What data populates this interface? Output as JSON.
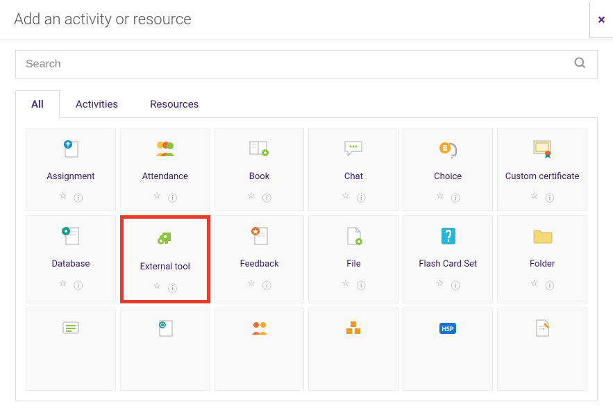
{
  "dialog": {
    "title": "Add an activity or resource",
    "close": "×"
  },
  "search": {
    "placeholder": "Search"
  },
  "tabs": {
    "all": "All",
    "activities": "Activities",
    "resources": "Resources"
  },
  "grid": {
    "items": [
      {
        "label": "Assignment",
        "icon": "assignment"
      },
      {
        "label": "Attendance",
        "icon": "attendance"
      },
      {
        "label": "Book",
        "icon": "book"
      },
      {
        "label": "Chat",
        "icon": "chat"
      },
      {
        "label": "Choice",
        "icon": "choice"
      },
      {
        "label": "Custom certificate",
        "icon": "certificate"
      },
      {
        "label": "Database",
        "icon": "database"
      },
      {
        "label": "External tool",
        "icon": "external-tool",
        "highlight": true
      },
      {
        "label": "Feedback",
        "icon": "feedback"
      },
      {
        "label": "File",
        "icon": "file"
      },
      {
        "label": "Flash Card Set",
        "icon": "flashcard"
      },
      {
        "label": "Folder",
        "icon": "folder"
      }
    ],
    "partial_items": [
      {
        "icon": "forum"
      },
      {
        "icon": "glossary"
      },
      {
        "icon": "group"
      },
      {
        "icon": "boxes"
      },
      {
        "icon": "h5p"
      },
      {
        "icon": "page"
      }
    ]
  }
}
